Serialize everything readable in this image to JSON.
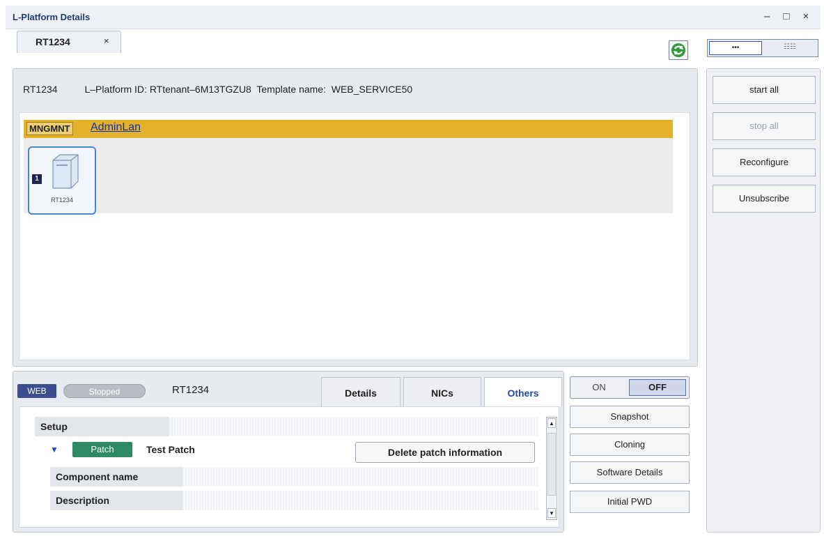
{
  "window": {
    "title": "L-Platform Details",
    "minimize": "–",
    "maximize": "□",
    "close": "×"
  },
  "tab": {
    "label": "RT1234",
    "close": "×"
  },
  "view_toggle": {
    "option_a": "•••",
    "option_b": "☷☷"
  },
  "header": {
    "text": "RT1234          L–Platform ID: RTtenant–6M13TGZU8  Template name:  WEB_SERVICE50"
  },
  "diagram": {
    "segment_tag": "MNGMNT",
    "segment_name": "AdminLan",
    "segment_color": "#e3b22a",
    "server": {
      "badge": "1",
      "name": "RT1234"
    }
  },
  "actions": {
    "start_all": "start all",
    "stop_all": "stop all",
    "reconfigure": "Reconfigure",
    "unsubscribe": "Unsubscribe"
  },
  "server_panel": {
    "type_badge": "WEB",
    "status": "Stopped",
    "name": "RT1234",
    "tabs": [
      "Details",
      "NICs",
      "Others"
    ],
    "selected_tab": "Others",
    "section_setup": "Setup",
    "patch_badge": "Patch",
    "patch_name": "Test Patch",
    "delete_button": "Delete patch information",
    "rows": [
      "Component name",
      "Description"
    ]
  },
  "power": {
    "on": "ON",
    "off": "OFF",
    "selected": "OFF"
  },
  "server_actions": {
    "snapshot": "Snapshot",
    "cloning": "Cloning",
    "software_details": "Software Details",
    "initial_pwd": "Initial PWD"
  }
}
